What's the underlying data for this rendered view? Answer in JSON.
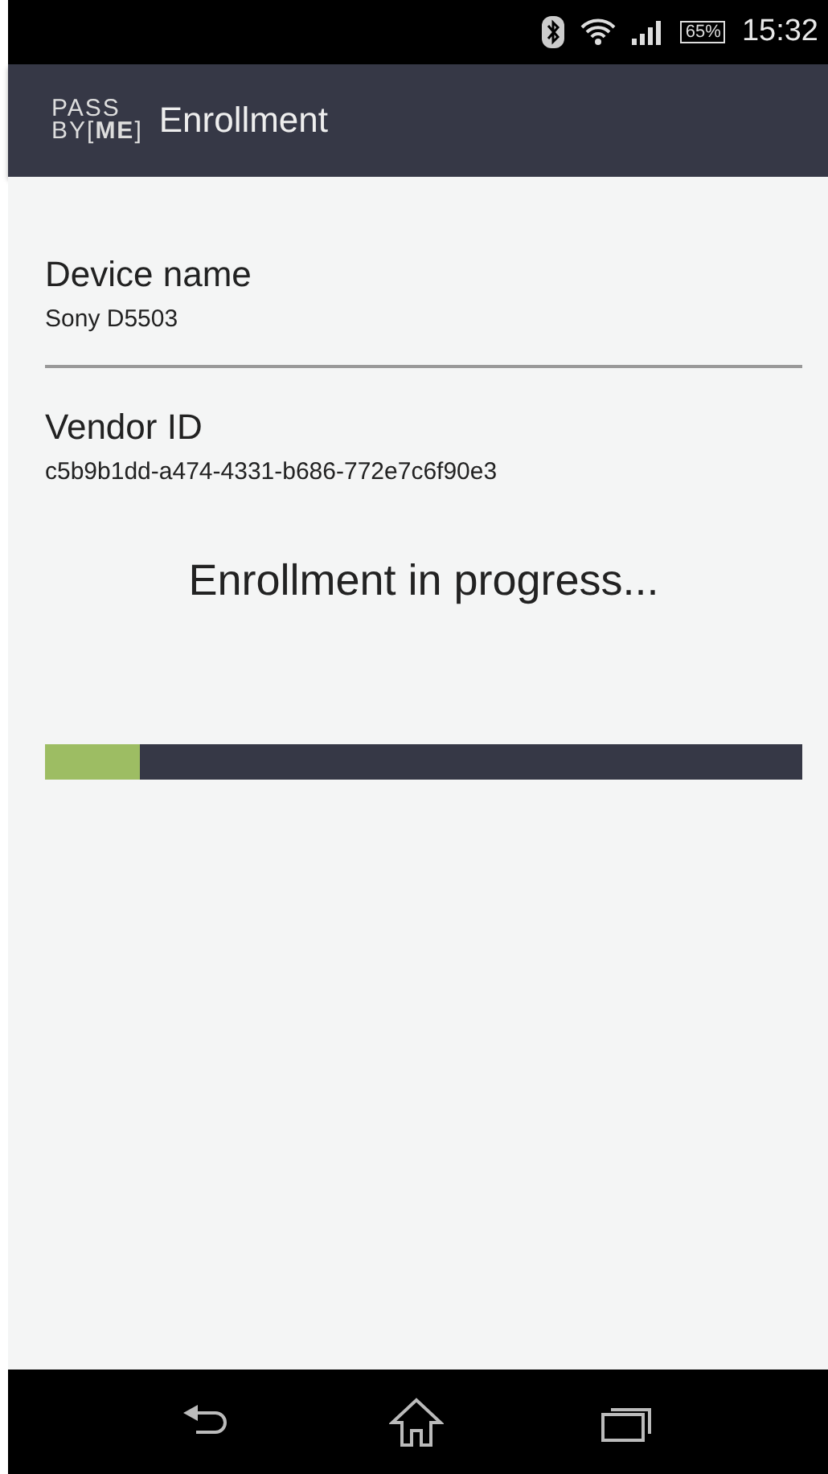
{
  "status_bar": {
    "battery": "65%",
    "time": "15:32"
  },
  "app_bar": {
    "logo_top": "PASS",
    "logo_bottom_prefix": "BY[",
    "logo_bottom_bold": "ME",
    "logo_bottom_suffix": "]",
    "title": "Enrollment"
  },
  "fields": [
    {
      "label": "Device name",
      "value": "Sony D5503"
    },
    {
      "label": "Vendor ID",
      "value": "c5b9b1dd-a474-4331-b686-772e7c6f90e3"
    }
  ],
  "status_message": "Enrollment in progress...",
  "progress": {
    "level": 0.125
  }
}
